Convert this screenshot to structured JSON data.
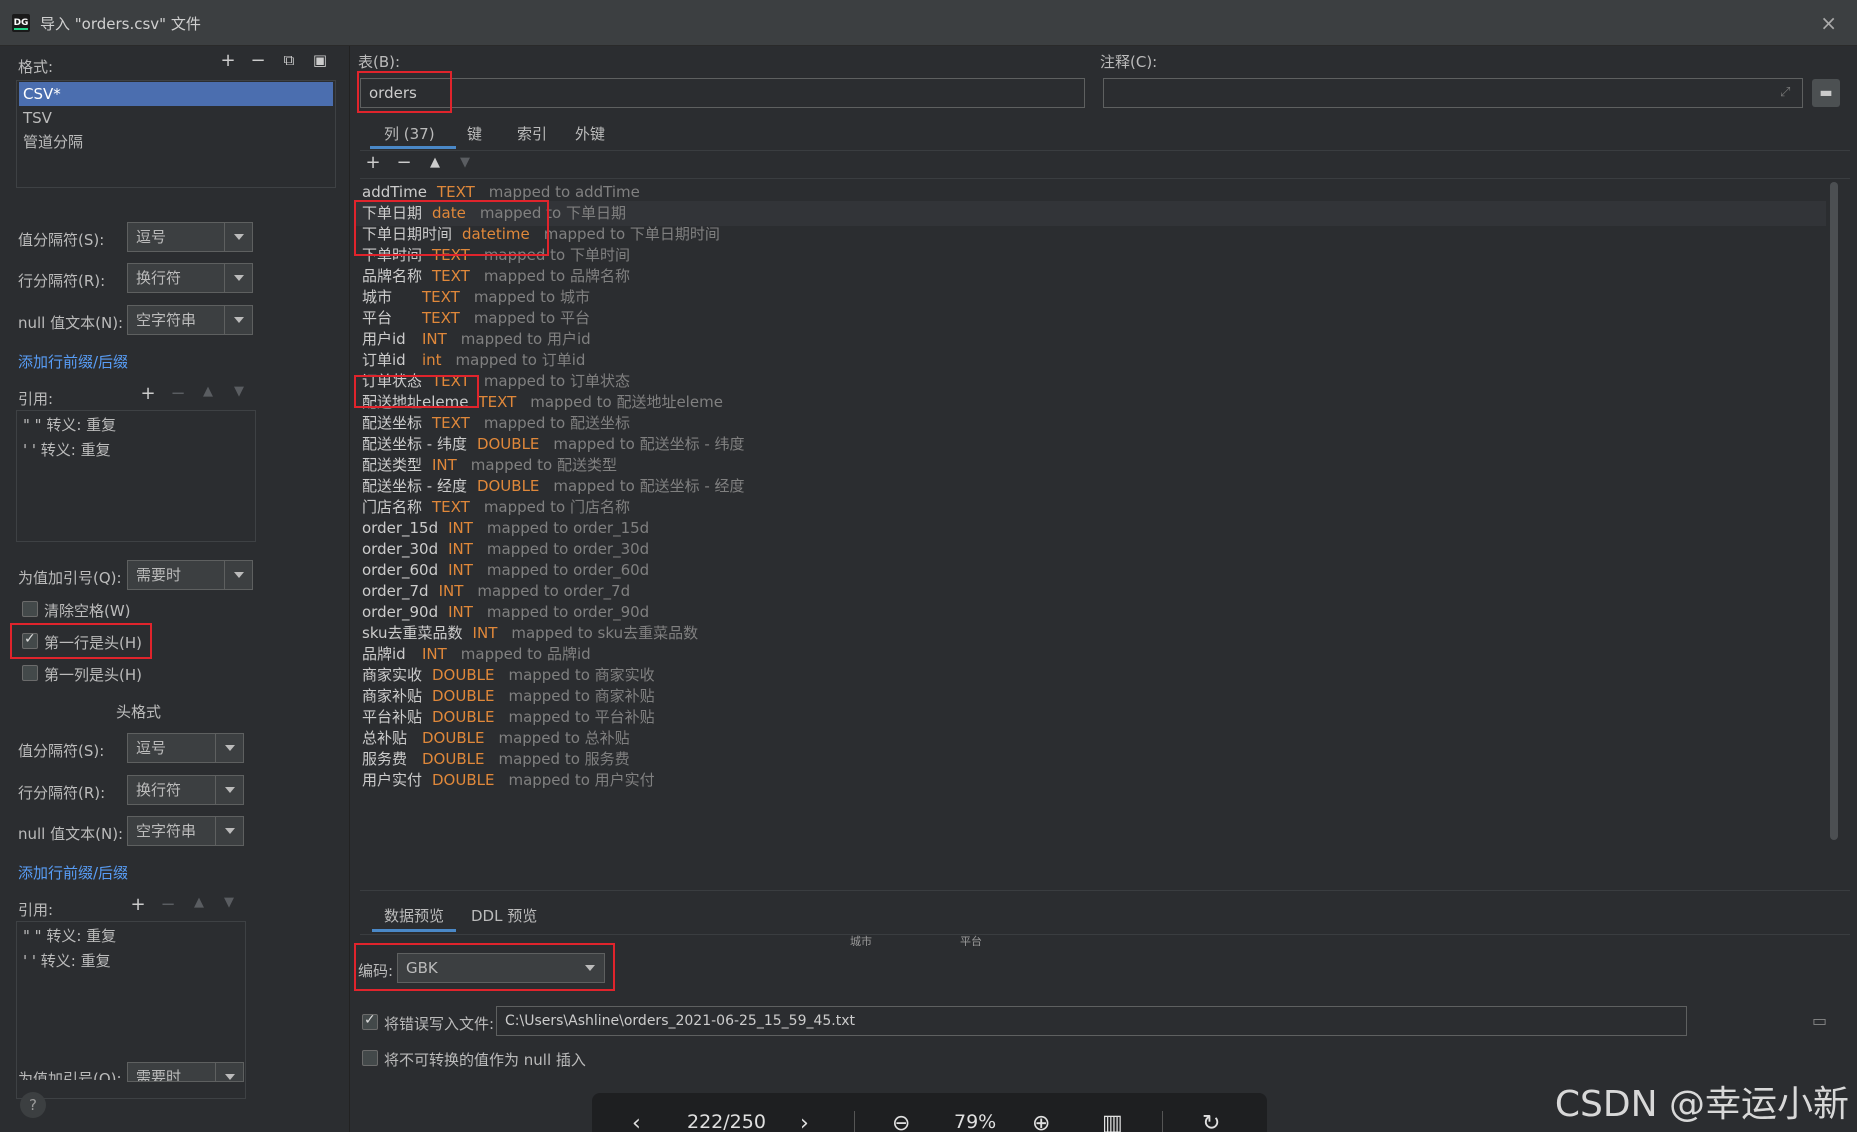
{
  "window": {
    "title": "导入 \"orders.csv\" 文件",
    "icon_label": "DG",
    "close_icon": "×"
  },
  "left": {
    "format_label": "格式:",
    "format_items": [
      "CSV*",
      "TSV",
      "管道分隔"
    ],
    "value_sep_label": "值分隔符(S):",
    "value_sep_value": "逗号",
    "row_sep_label": "行分隔符(R):",
    "row_sep_value": "换行符",
    "null_text_label": "null 值文本(N):",
    "null_text_value": "空字符串",
    "add_prefix_link": "添加行前缀/后缀",
    "quote_label": "引用:",
    "quote_items": [
      "\" \"  转义: 重复",
      "' '  转义: 重复"
    ],
    "quote_values_label": "为值加引号(Q):",
    "quote_values_value": "需要时",
    "trim_label": "清除空格(W)",
    "first_row_header_label": "第一行是头(H)",
    "first_col_header_label": "第一列是头(H)",
    "header_format_label": "头格式",
    "h_value_sep_label": "值分隔符(S):",
    "h_value_sep_value": "逗号",
    "h_row_sep_label": "行分隔符(R):",
    "h_row_sep_value": "换行符",
    "h_null_text_label": "null 值文本(N):",
    "h_null_text_value": "空字符串",
    "h_add_prefix_link": "添加行前缀/后缀",
    "h_quote_label": "引用:",
    "h_quote_items": [
      "\" \"  转义: 重复",
      "' '  转义: 重复"
    ],
    "h_quote_values_label": "为值加引号(Q):",
    "h_quote_values_value": "需要时"
  },
  "right": {
    "table_label": "表(B):",
    "table_value": "orders",
    "comment_label": "注释(C):",
    "comment_value": "",
    "tabs": [
      "列 (37)",
      "键",
      "索引",
      "外键"
    ],
    "columns": [
      {
        "name": "addTime",
        "type": "TEXT",
        "map": "mapped to addTime"
      },
      {
        "name": "下单日期",
        "type": "date",
        "map": "mapped to 下单日期"
      },
      {
        "name": "下单日期时间",
        "type": "datetime",
        "map": "mapped to 下单日期时间"
      },
      {
        "name": "下单时间",
        "type": "TEXT",
        "map": "mapped to 下单时间"
      },
      {
        "name": "品牌名称",
        "type": "TEXT",
        "map": "mapped to 品牌名称"
      },
      {
        "name": "城市",
        "type": "TEXT",
        "map": "mapped to 城市"
      },
      {
        "name": "平台",
        "type": "TEXT",
        "map": "mapped to 平台"
      },
      {
        "name": "用户id",
        "type": "INT",
        "map": "mapped to 用户id"
      },
      {
        "name": "订单id",
        "type": "int",
        "map": "mapped to 订单id"
      },
      {
        "name": "订单状态",
        "type": "TEXT",
        "map": "mapped to 订单状态"
      },
      {
        "name": "配送地址eleme",
        "type": "TEXT",
        "map": "mapped to 配送地址eleme"
      },
      {
        "name": "配送坐标",
        "type": "TEXT",
        "map": "mapped to 配送坐标"
      },
      {
        "name": "配送坐标 - 纬度",
        "type": "DOUBLE",
        "map": "mapped to 配送坐标 - 纬度"
      },
      {
        "name": "配送类型",
        "type": "INT",
        "map": "mapped to 配送类型"
      },
      {
        "name": "配送坐标 - 经度",
        "type": "DOUBLE",
        "map": "mapped to 配送坐标 - 经度"
      },
      {
        "name": "门店名称",
        "type": "TEXT",
        "map": "mapped to 门店名称"
      },
      {
        "name": "order_15d",
        "type": "INT",
        "map": "mapped to order_15d"
      },
      {
        "name": "order_30d",
        "type": "INT",
        "map": "mapped to order_30d"
      },
      {
        "name": "order_60d",
        "type": "INT",
        "map": "mapped to order_60d"
      },
      {
        "name": "order_7d",
        "type": "INT",
        "map": "mapped to order_7d"
      },
      {
        "name": "order_90d",
        "type": "INT",
        "map": "mapped to order_90d"
      },
      {
        "name": "sku去重菜品数",
        "type": "INT",
        "map": "mapped to sku去重菜品数"
      },
      {
        "name": "品牌id",
        "type": "INT",
        "map": "mapped to 品牌id"
      },
      {
        "name": "商家实收",
        "type": "DOUBLE",
        "map": "mapped to 商家实收"
      },
      {
        "name": "商家补贴",
        "type": "DOUBLE",
        "map": "mapped to 商家补贴"
      },
      {
        "name": "平台补贴",
        "type": "DOUBLE",
        "map": "mapped to 平台补贴"
      },
      {
        "name": "总补贴",
        "type": "DOUBLE",
        "map": "mapped to 总补贴"
      },
      {
        "name": "服务费",
        "type": "DOUBLE",
        "map": "mapped to 服务费"
      },
      {
        "name": "用户实付",
        "type": "DOUBLE",
        "map": "mapped to 用户实付"
      }
    ],
    "preview_tabs": [
      "数据预览",
      "DDL 预览"
    ],
    "preview_header_cells": [
      "城市",
      "平台"
    ],
    "encoding_label": "编码:",
    "encoding_value": "GBK",
    "write_errors_label": "将错误写入文件:",
    "write_errors_path": "C:\\Users\\Ashline\\orders_2021-06-25_15_59_45.txt",
    "null_insert_label": "将不可转换的值作为 null 插入"
  },
  "viewer": {
    "page": "222/250",
    "zoom": "79%"
  },
  "watermark": "CSDN @幸运小新",
  "help": "?"
}
